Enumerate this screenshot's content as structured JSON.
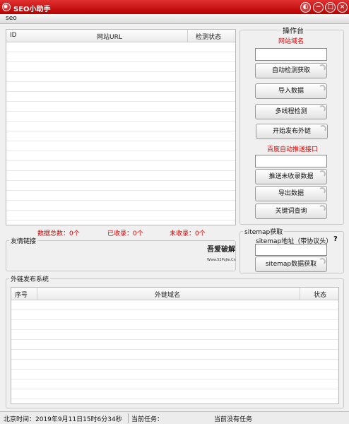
{
  "window": {
    "title": "SEO小助手",
    "skin_symbol": "◐",
    "min_symbol": "−",
    "max_symbol": "□",
    "close_symbol": "×"
  },
  "menu": {
    "items": [
      "seo"
    ]
  },
  "domain_grid": {
    "columns": [
      "ID",
      "网站URL",
      "检测状态"
    ],
    "rows": [],
    "stats": {
      "total": "数据总数：0个",
      "indexed": "已收录：0个",
      "not_indexed": "未收录：0个"
    }
  },
  "console": {
    "title": "操作台",
    "domain_label": "网站域名",
    "domain_value": "",
    "buttons": {
      "auto_detect": "自动检测获取",
      "import": "导入数据",
      "multithread": "多线程检测",
      "publish_links": "开始发布外链"
    },
    "baidu_label": "百度自动推送接口",
    "baidu_value": "",
    "buttons2": {
      "push_unindexed": "推送未收录数据",
      "export": "导出数据",
      "keyword_query": "关键词查询"
    }
  },
  "friend_links": {
    "title": "友情链接",
    "logo_text": "吾爱破解",
    "logo_sub": "Www.52PoJie.Cn"
  },
  "sitemap": {
    "title": "sitemap获取",
    "label": "sitemap地址（带协议头）",
    "help": "?",
    "value": "",
    "button": "sitemap数据获取"
  },
  "publish_system": {
    "title": "外链发布系统",
    "columns": [
      "序号",
      "外链域名",
      "状态"
    ],
    "rows": []
  },
  "status": {
    "time": "北京时间：2019年9月11日15时6分34秒",
    "task_label": "当前任务：",
    "task_value": "当前没有任务"
  }
}
